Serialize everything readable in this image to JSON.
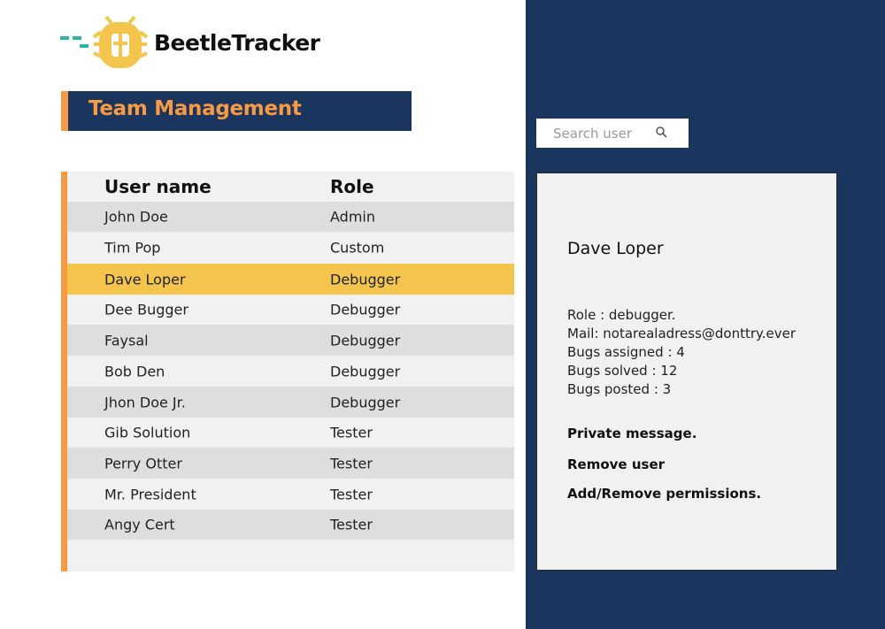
{
  "app": {
    "name": "BeetleTracker",
    "colors": {
      "navy": "#1a355e",
      "orange": "#f79a42",
      "yellow": "#f3c54d",
      "teal": "#2bb5a6"
    }
  },
  "page": {
    "title": "Team Management"
  },
  "table": {
    "headers": {
      "user_name": "User name",
      "role": "Role"
    },
    "rows": [
      {
        "name": "John Doe",
        "role": "Admin"
      },
      {
        "name": "Tim Pop",
        "role": "Custom"
      },
      {
        "name": "Dave Loper",
        "role": "Debugger"
      },
      {
        "name": "Dee Bugger",
        "role": "Debugger"
      },
      {
        "name": "Faysal",
        "role": "Debugger"
      },
      {
        "name": "Bob Den",
        "role": "Debugger"
      },
      {
        "name": "Jhon Doe Jr.",
        "role": "Debugger"
      },
      {
        "name": "Gib Solution",
        "role": "Tester"
      },
      {
        "name": "Perry Otter",
        "role": "Tester"
      },
      {
        "name": "Mr. President",
        "role": "Tester"
      },
      {
        "name": "Angy Cert",
        "role": "Tester"
      }
    ],
    "selected_name": "Dave Loper"
  },
  "search": {
    "placeholder": "Search user",
    "icon": "search-icon"
  },
  "details": {
    "name": "Dave Loper",
    "role_line": "Role : debugger.",
    "mail_line": "Mail: notarealadress@donttry.ever",
    "assigned_line": "Bugs assigned : 4",
    "solved_line": "Bugs solved : 12",
    "posted_line": "Bugs posted : 3",
    "actions": {
      "message": "Private message.",
      "remove": "Remove user",
      "permissions": "Add/Remove permissions."
    }
  }
}
